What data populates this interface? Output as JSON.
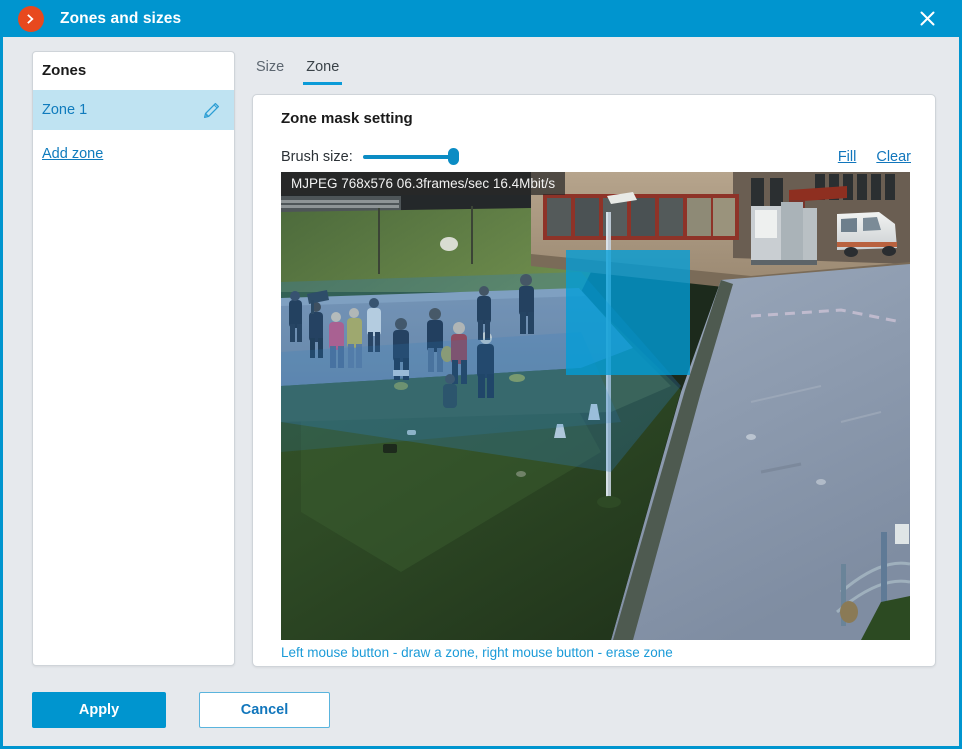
{
  "titlebar": {
    "icon": "chevron-right-circle-icon",
    "title": "Zones and sizes",
    "close_icon": "close-icon"
  },
  "sidebar": {
    "heading": "Zones",
    "zones": [
      {
        "label": "Zone 1",
        "edit_icon": "pencil-icon",
        "selected": true
      }
    ],
    "add_zone_label": "Add zone"
  },
  "tabs": [
    {
      "label": "Size",
      "active": false
    },
    {
      "label": "Zone",
      "active": true
    }
  ],
  "panel": {
    "title": "Zone mask setting",
    "brush_label": "Brush size:",
    "brush_value": 100,
    "fill_label": "Fill",
    "clear_label": "Clear",
    "hint": "Left mouse button - draw a zone, right mouse button - erase zone"
  },
  "video": {
    "osd": "MJPEG 768x576 06.3frames/sec 16.4Mbit/s",
    "codec": "MJPEG",
    "resolution": "768x576",
    "framerate": "06.3frames/sec",
    "bitrate": "16.4Mbit/s",
    "mask_color": "#009ed8",
    "scene_description": "CCTV view of a campus courtyard: brick building with red-framed windows, white van parked on tarmac road, green lawn, pedestrians walking along a path, lamppost"
  },
  "footer": {
    "apply_label": "Apply",
    "cancel_label": "Cancel"
  },
  "colors": {
    "accent": "#0095cf",
    "title_icon": "#e8491e",
    "link": "#1176bc",
    "selected_row": "#bfe3f2",
    "hint": "#1b9bd8",
    "window_bg": "#e6e9ed"
  }
}
